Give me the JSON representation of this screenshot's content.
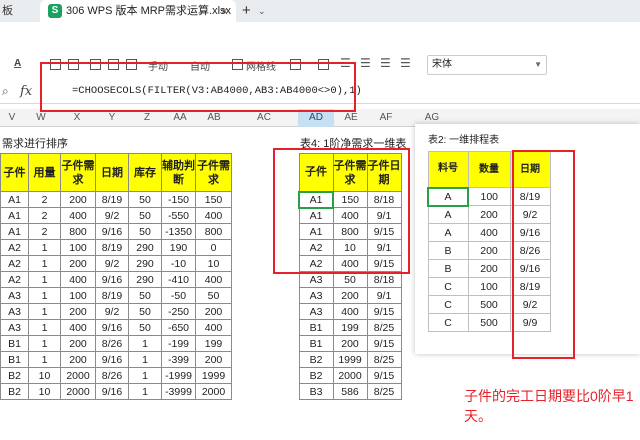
{
  "tabs": {
    "left_label": "板",
    "active_label": "306 WPS 版本 MRP需求运算.xlsx",
    "sheet_icon": "S",
    "close_glyph": "×",
    "add_glyph": "+",
    "more_glyph": "⌄"
  },
  "toolbar": {
    "font_color_label": "A",
    "ribbon_items": [
      "手动",
      "自动",
      "网格线"
    ],
    "font_name": "宋体"
  },
  "formula_bar": {
    "fx": "fx",
    "formula": "=CHOOSECOLS(FILTER(V3:AB4000,AB3:AB4000<>0),1)"
  },
  "columns": {
    "left": [
      "V",
      "W",
      "X",
      "Y",
      "Z",
      "AA",
      "AB",
      "AC",
      "AD",
      "AE",
      "AF",
      "AG"
    ],
    "selected": "AD"
  },
  "headings": {
    "left": "需求进行排序",
    "table4": "表4: 1阶净需求一维表",
    "table2": "表2: 一维排程表"
  },
  "main_table": {
    "headers": [
      "子件",
      "用量",
      "子件需求",
      "日期",
      "库存",
      "辅助判断",
      "子件需求"
    ],
    "rows": [
      [
        "A1",
        "2",
        "200",
        "8/19",
        "50",
        "-150",
        "150"
      ],
      [
        "A1",
        "2",
        "400",
        "9/2",
        "50",
        "-550",
        "400"
      ],
      [
        "A1",
        "2",
        "800",
        "9/16",
        "50",
        "-1350",
        "800"
      ],
      [
        "A2",
        "1",
        "100",
        "8/19",
        "290",
        "190",
        "0"
      ],
      [
        "A2",
        "1",
        "200",
        "9/2",
        "290",
        "-10",
        "10"
      ],
      [
        "A2",
        "1",
        "400",
        "9/16",
        "290",
        "-410",
        "400"
      ],
      [
        "A3",
        "1",
        "100",
        "8/19",
        "50",
        "-50",
        "50"
      ],
      [
        "A3",
        "1",
        "200",
        "9/2",
        "50",
        "-250",
        "200"
      ],
      [
        "A3",
        "1",
        "400",
        "9/16",
        "50",
        "-650",
        "400"
      ],
      [
        "B1",
        "1",
        "200",
        "8/26",
        "1",
        "-199",
        "199"
      ],
      [
        "B1",
        "1",
        "200",
        "9/16",
        "1",
        "-399",
        "200"
      ],
      [
        "B2",
        "10",
        "2000",
        "8/26",
        "1",
        "-1999",
        "1999"
      ],
      [
        "B2",
        "10",
        "2000",
        "9/16",
        "1",
        "-3999",
        "2000"
      ]
    ]
  },
  "table4": {
    "headers": [
      "子件",
      "子件需求",
      "子件日期"
    ],
    "rows": [
      [
        "A1",
        "150",
        "8/18"
      ],
      [
        "A1",
        "400",
        "9/1"
      ],
      [
        "A1",
        "800",
        "9/15"
      ],
      [
        "A2",
        "10",
        "9/1"
      ],
      [
        "A2",
        "400",
        "9/15"
      ],
      [
        "A3",
        "50",
        "8/18"
      ],
      [
        "A3",
        "200",
        "9/1"
      ],
      [
        "A3",
        "400",
        "9/15"
      ],
      [
        "B1",
        "199",
        "8/25"
      ],
      [
        "B1",
        "200",
        "9/15"
      ],
      [
        "B2",
        "1999",
        "8/25"
      ],
      [
        "B2",
        "2000",
        "9/15"
      ],
      [
        "B3",
        "586",
        "8/25"
      ]
    ]
  },
  "table2": {
    "headers": [
      "料号",
      "数量",
      "日期"
    ],
    "rows": [
      [
        "A",
        "100",
        "8/19"
      ],
      [
        "A",
        "200",
        "9/2"
      ],
      [
        "A",
        "400",
        "9/16"
      ],
      [
        "B",
        "200",
        "8/26"
      ],
      [
        "B",
        "200",
        "9/16"
      ],
      [
        "C",
        "100",
        "8/19"
      ],
      [
        "C",
        "500",
        "9/2"
      ],
      [
        "C",
        "500",
        "9/9"
      ]
    ]
  },
  "note": "子件的完工日期要比0阶早1天。",
  "colors": {
    "header_yellow": "#ffff00",
    "annotation_red": "#e8202a",
    "active_green": "#27a048",
    "selected_col": "#c6dff2"
  }
}
